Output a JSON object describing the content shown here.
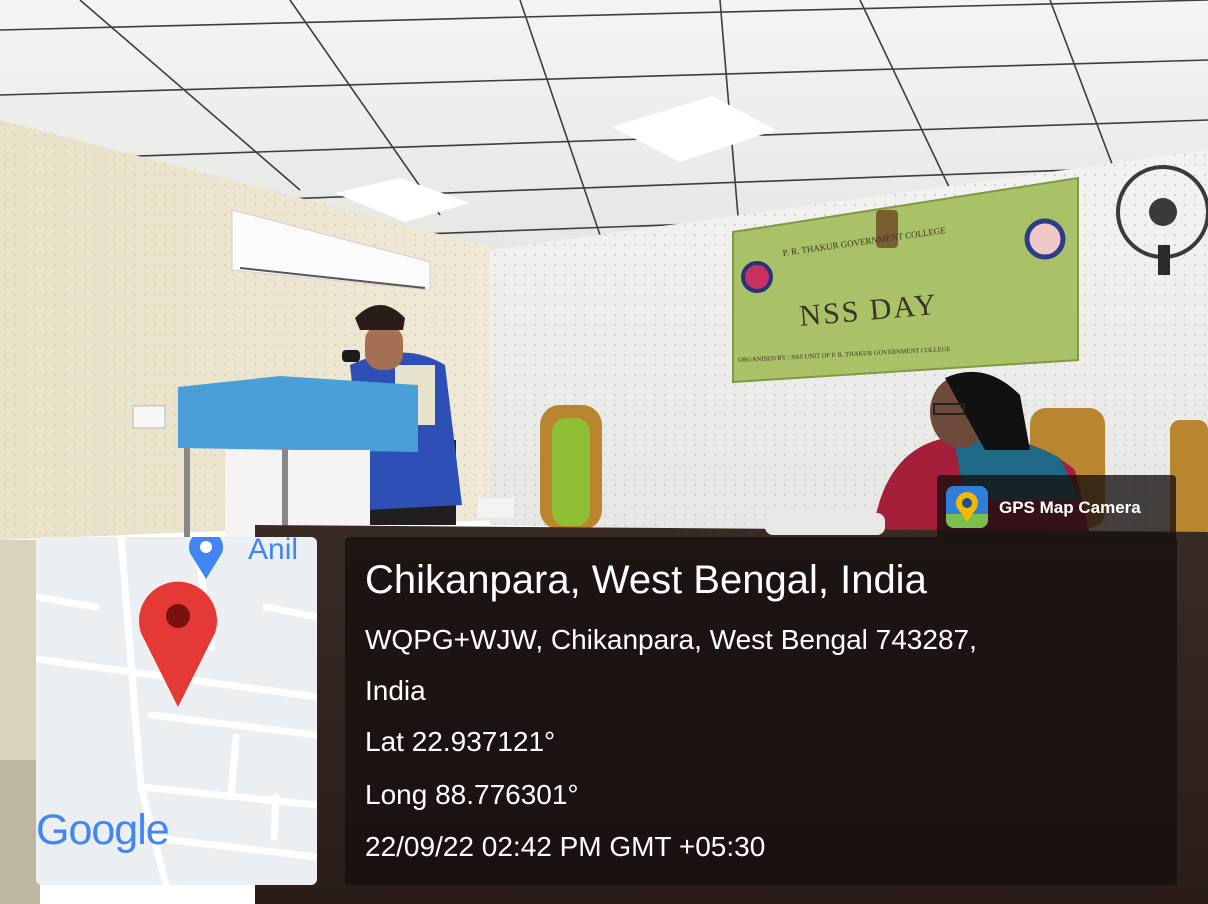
{
  "banner": {
    "college": "P. R. THAKUR GOVERNMENT COLLEGE",
    "title": "NSS DAY",
    "organised_by": "ORGANISED BY : NSS UNIT OF P. R. THAKUR GOVERNMENT COLLEGE"
  },
  "gps_app": {
    "label": "GPS Map Camera",
    "icon": "gps-map-camera-icon"
  },
  "map": {
    "place_label": "Anil",
    "logo": "Google",
    "icons": [
      "map-pin-icon",
      "place-marker-icon"
    ]
  },
  "location": {
    "title": "Chikanpara, West Bengal, India",
    "address_line1": "WQPG+WJW, Chikanpara, West Bengal 743287,",
    "address_line2": "India",
    "lat": "Lat 22.937121°",
    "long": "Long 88.776301°",
    "timestamp": "22/09/22 02:42 PM GMT +05:30"
  },
  "colors": {
    "banner_green": "#a9c268",
    "vest_blue": "#2e4fb5",
    "podium_blue": "#4b9fd8",
    "map_pin_red": "#e53935",
    "overlay_dark": "#14100e"
  }
}
